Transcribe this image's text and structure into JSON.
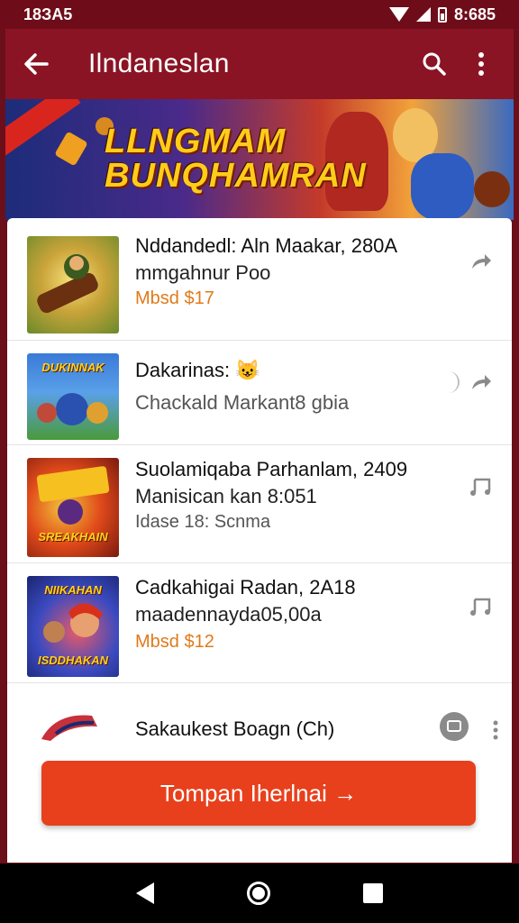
{
  "status_bar": {
    "time": "18ЗА5",
    "right_time": "8:685"
  },
  "app_bar": {
    "title": "Ilndaneslan"
  },
  "banner": {
    "title_line1": "LLNGMAM",
    "title_line2": "BUNQHAMRAN"
  },
  "list": [
    {
      "title": "Nddandedl: Aln Maakar, 280A",
      "subtitle": "mmgahnur Poo",
      "meta": "Mbsd $17",
      "meta_style": "price",
      "thumb_text": "",
      "action_icon": "share-icon"
    },
    {
      "title": "Dakarinas: 😺",
      "subtitle": "Chackald Markant8 gbia",
      "meta": "",
      "meta_style": "",
      "thumb_text": "DUKINNAK",
      "action_icon": "share-icon"
    },
    {
      "title": "Suolamiqaba Parhanlam, 2409",
      "subtitle": "Manisican kan 8:051",
      "meta": "Idase 18: Scnma",
      "meta_style": "muted",
      "thumb_text": "SREAKHAIN",
      "action_icon": "music-icon"
    },
    {
      "title": "Cadkahigai Radan, 2A18",
      "subtitle": "maadennayda05,00a",
      "meta": "Mbsd $12",
      "meta_style": "price",
      "thumb_text": "ISDDHAKAN",
      "action_icon": "music-icon"
    },
    {
      "title": "Sakaukest Boagn (Ch)",
      "subtitle": "",
      "meta": "",
      "meta_style": "",
      "thumb_text": "",
      "action_icon": "cast-icon"
    }
  ],
  "cta": {
    "label": "Tompan Iherlnai →"
  },
  "colors": {
    "app_bar": "#8a1424",
    "status_bar": "#6e0d19",
    "cta": "#e8401c",
    "price": "#e07a1a"
  }
}
